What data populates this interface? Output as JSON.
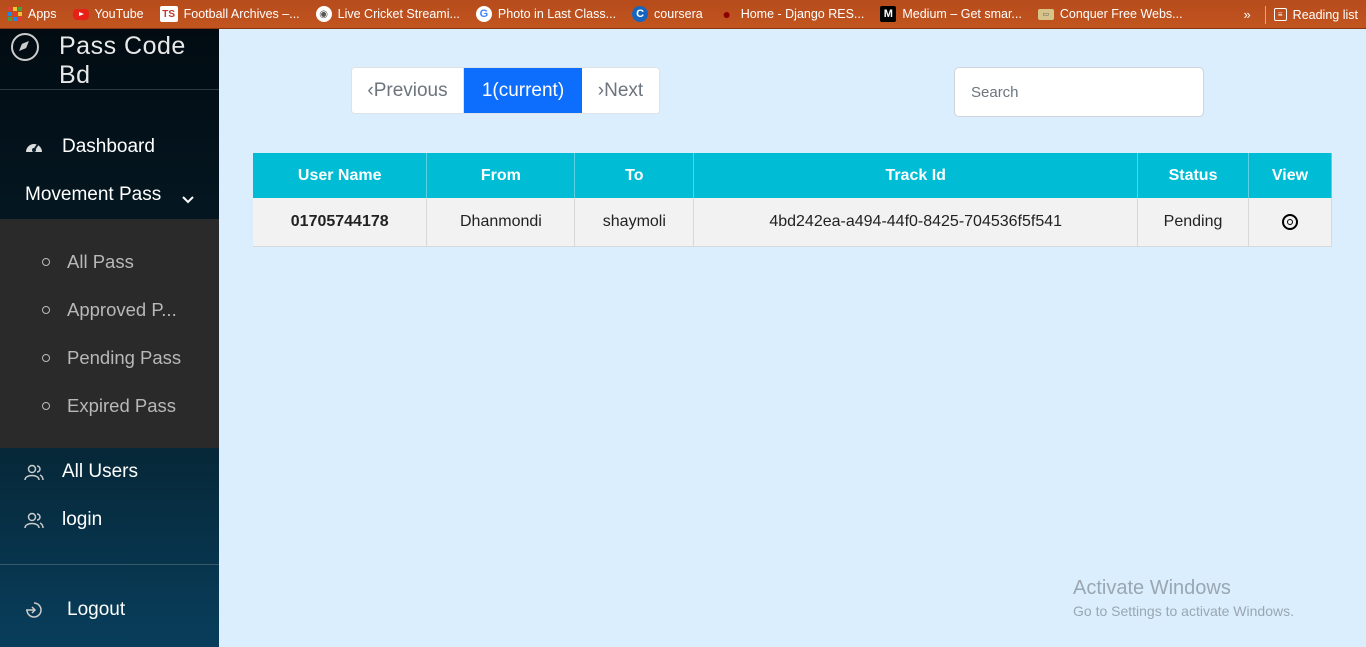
{
  "bookmarks": [
    {
      "label": "Apps",
      "icon": "apps-grid-icon"
    },
    {
      "label": "YouTube",
      "icon": "youtube-icon"
    },
    {
      "label": "Football Archives –...",
      "icon": "ts-icon"
    },
    {
      "label": "Live Cricket Streami...",
      "icon": "globe-icon"
    },
    {
      "label": "Photo in Last Class...",
      "icon": "google-icon"
    },
    {
      "label": "coursera",
      "icon": "coursera-icon"
    },
    {
      "label": "Home - Django RES...",
      "icon": "django-icon"
    },
    {
      "label": "Medium – Get smar...",
      "icon": "medium-icon"
    },
    {
      "label": "Conquer Free Webs...",
      "icon": "conquer-icon"
    }
  ],
  "bookmarks_more": "»",
  "reading_list": "Reading list",
  "brand": {
    "title": "Pass Code Bd"
  },
  "nav": {
    "dashboard": "Dashboard",
    "movement_pass": "Movement Pass",
    "all_users": "All Users",
    "login": "login",
    "logout": "Logout"
  },
  "submenu": [
    "All Pass",
    "Approved P...",
    "Pending Pass",
    "Expired Pass"
  ],
  "pagination": {
    "previous": "‹Previous",
    "current": "1(current)",
    "next": "›Next"
  },
  "search": {
    "placeholder": "Search"
  },
  "table": {
    "headers": [
      "User Name",
      "From",
      "To",
      "Track Id",
      "Status",
      "View"
    ],
    "rows": [
      {
        "user_name": "01705744178",
        "from": "Dhanmondi",
        "to": "shaymoli",
        "track_id": "4bd242ea-a494-44f0-8425-704536f5f541",
        "status": "Pending"
      }
    ]
  },
  "watermark": {
    "line1": "Activate Windows",
    "line2": "Go to Settings to activate Windows."
  }
}
